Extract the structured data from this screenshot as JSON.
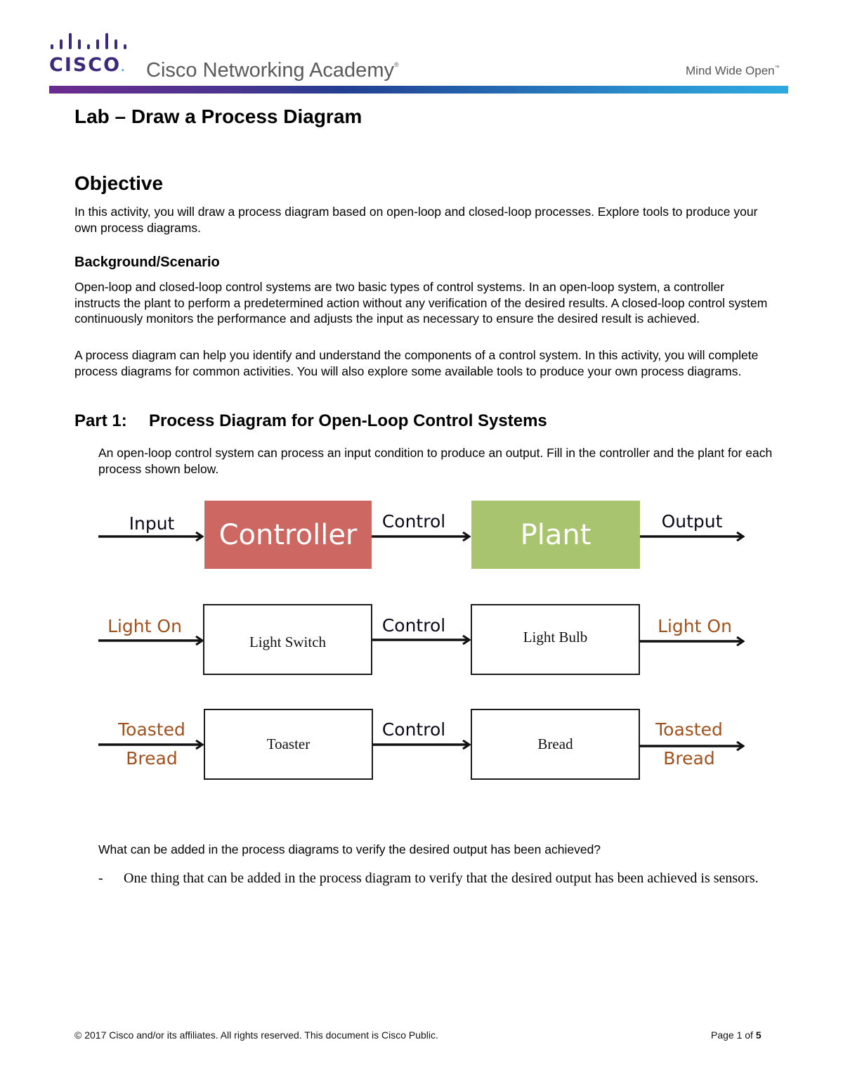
{
  "header": {
    "brand_word": "CISCO",
    "academy_name": "Cisco Networking Academy",
    "academy_mark": "®",
    "tagline": "Mind Wide Open",
    "tagline_mark": "™",
    "colors": {
      "brand_purple": "#3b2a7a",
      "brand_blue": "#2aa7df",
      "gradient_start": "#6b2c8e",
      "gradient_end": "#2ea9e0"
    }
  },
  "document": {
    "title": "Lab – Draw a Process Diagram",
    "objective": {
      "heading": "Objective",
      "text": "In this activity, you will draw a process diagram based on open-loop and closed-loop processes. Explore tools to produce your own process diagrams."
    },
    "background": {
      "heading": "Background/Scenario",
      "paragraphs": [
        "Open-loop and closed-loop control systems are two basic types of control systems. In an open-loop system, a controller instructs the plant to perform a predetermined action without any verification of the desired results. A closed-loop control system continuously monitors the performance and adjusts the input as necessary to ensure the desired result is achieved.",
        "A process diagram can help you identify and understand the components of a control system. In this activity, you will complete process diagrams for common activities. You will also explore some available tools to produce your own process diagrams."
      ]
    },
    "part1": {
      "number": "Part 1:",
      "heading": "Process Diagram for Open-Loop Control Systems",
      "intro": "An open-loop control system can process an input condition to produce an output. Fill in the controller and the plant for each process shown below.",
      "diagram": {
        "rows": [
          {
            "input": "Input",
            "controller": "Controller",
            "control": "Control",
            "plant": "Plant",
            "output": "Output"
          },
          {
            "input": "Light On",
            "controller": "Light Switch",
            "control": "Control",
            "plant": "Light Bulb",
            "output": "Light On"
          },
          {
            "input": "Toasted Bread",
            "input_lines": [
              "Toasted",
              "Bread"
            ],
            "controller": "Toaster",
            "control": "Control",
            "plant": "Bread",
            "output": "Toasted Bread",
            "output_lines": [
              "Toasted",
              "Bread"
            ]
          }
        ],
        "colors": {
          "controller_fill": "#cd6761",
          "plant_fill": "#a9c46e",
          "label_black": "#0a0a1a",
          "label_brown": "#a0521e"
        }
      },
      "question": "What can be added in the process diagrams to verify the desired output has been achieved?",
      "answer_bullet": "-",
      "answer": "One thing that can be added in the process diagram to verify that the desired output has been achieved is sensors."
    }
  },
  "footer": {
    "copyright": "© 2017 Cisco and/or its affiliates. All rights reserved. This document is Cisco Public.",
    "page_prefix": "Page 1 of ",
    "page_total": "5"
  }
}
